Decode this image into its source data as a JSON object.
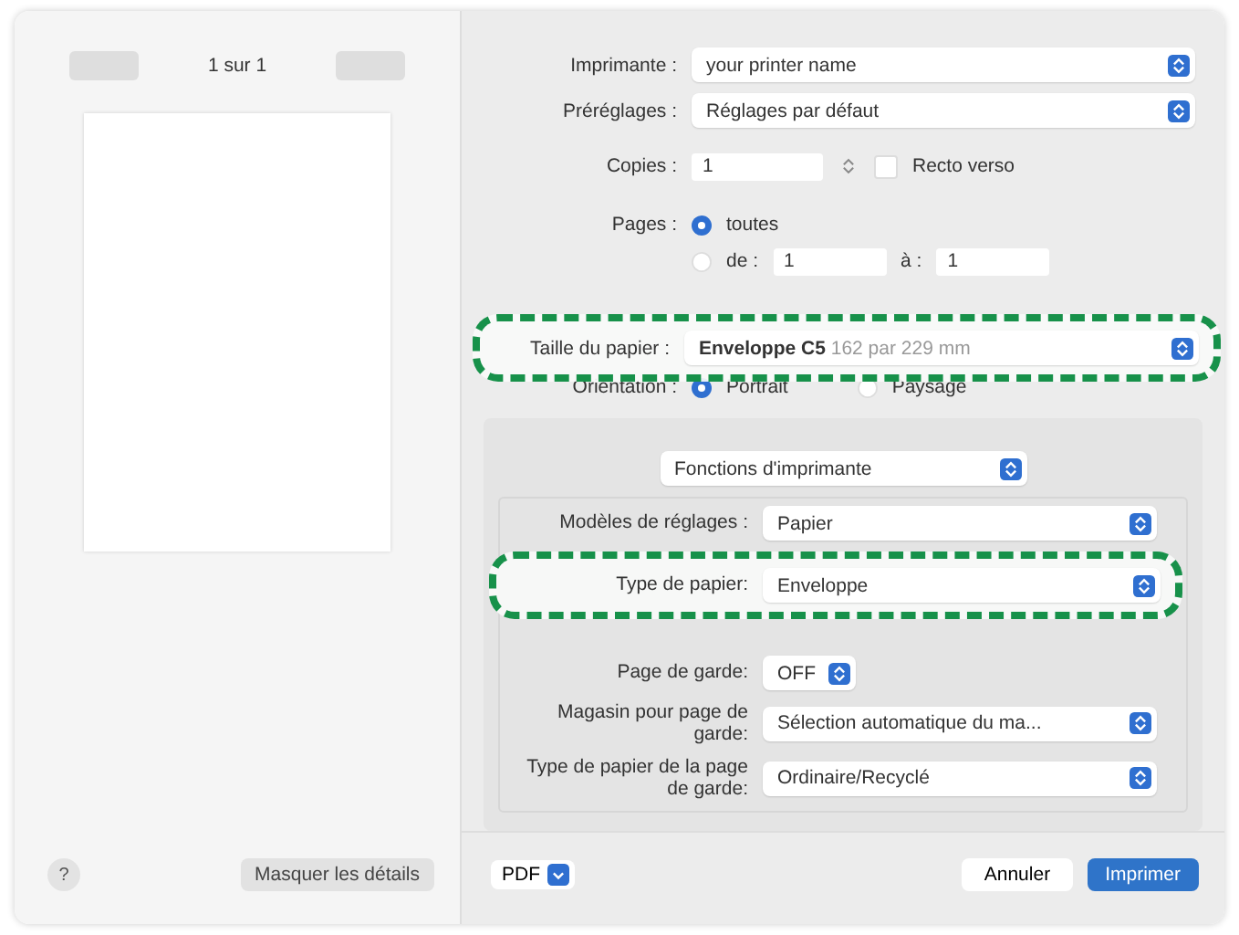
{
  "preview": {
    "page_indicator": "1 sur 1"
  },
  "settings": {
    "printer": {
      "label": "Imprimante :",
      "value": "your printer name"
    },
    "presets": {
      "label": "Préréglages :",
      "value": "Réglages par défaut"
    },
    "copies": {
      "label": "Copies :",
      "value": "1"
    },
    "two_sided": {
      "label": "Recto verso",
      "checked": false
    },
    "pages": {
      "label": "Pages :",
      "options": [
        {
          "label": "toutes",
          "selected": true
        },
        {
          "label": "de :",
          "selected": false
        }
      ],
      "from": "1",
      "to_label": "à :",
      "to": "1"
    },
    "paper_size": {
      "label": "Taille du papier :",
      "value": "Enveloppe C5",
      "detail": "162 par 229 mm",
      "highlighted": true
    },
    "orientation": {
      "label": "Orientation :",
      "options": [
        {
          "label": "Portrait",
          "selected": true
        },
        {
          "label": "Paysage",
          "selected": false
        }
      ]
    },
    "section": {
      "value": "Fonctions d'imprimante"
    },
    "rows": [
      {
        "kind": "popup",
        "label": "Modèles de réglages :",
        "value": "Papier",
        "highlighted": false
      },
      {
        "kind": "popup",
        "label": "Type de papier:",
        "value": "Enveloppe",
        "highlighted": true
      },
      {
        "kind": "short",
        "label": "Page de garde:",
        "value": "OFF",
        "highlighted": false
      },
      {
        "kind": "popup",
        "label": "Magasin pour page de garde:",
        "value": "Sélection automatique du ma...",
        "highlighted": false
      },
      {
        "kind": "popup",
        "label": "Type de papier de la page de garde:",
        "value": "Ordinaire/Recyclé",
        "highlighted": false
      }
    ]
  },
  "footer": {
    "help": "?",
    "hide_details": "Masquer les détails",
    "pdf": "PDF",
    "cancel": "Annuler",
    "print": "Imprimer"
  }
}
